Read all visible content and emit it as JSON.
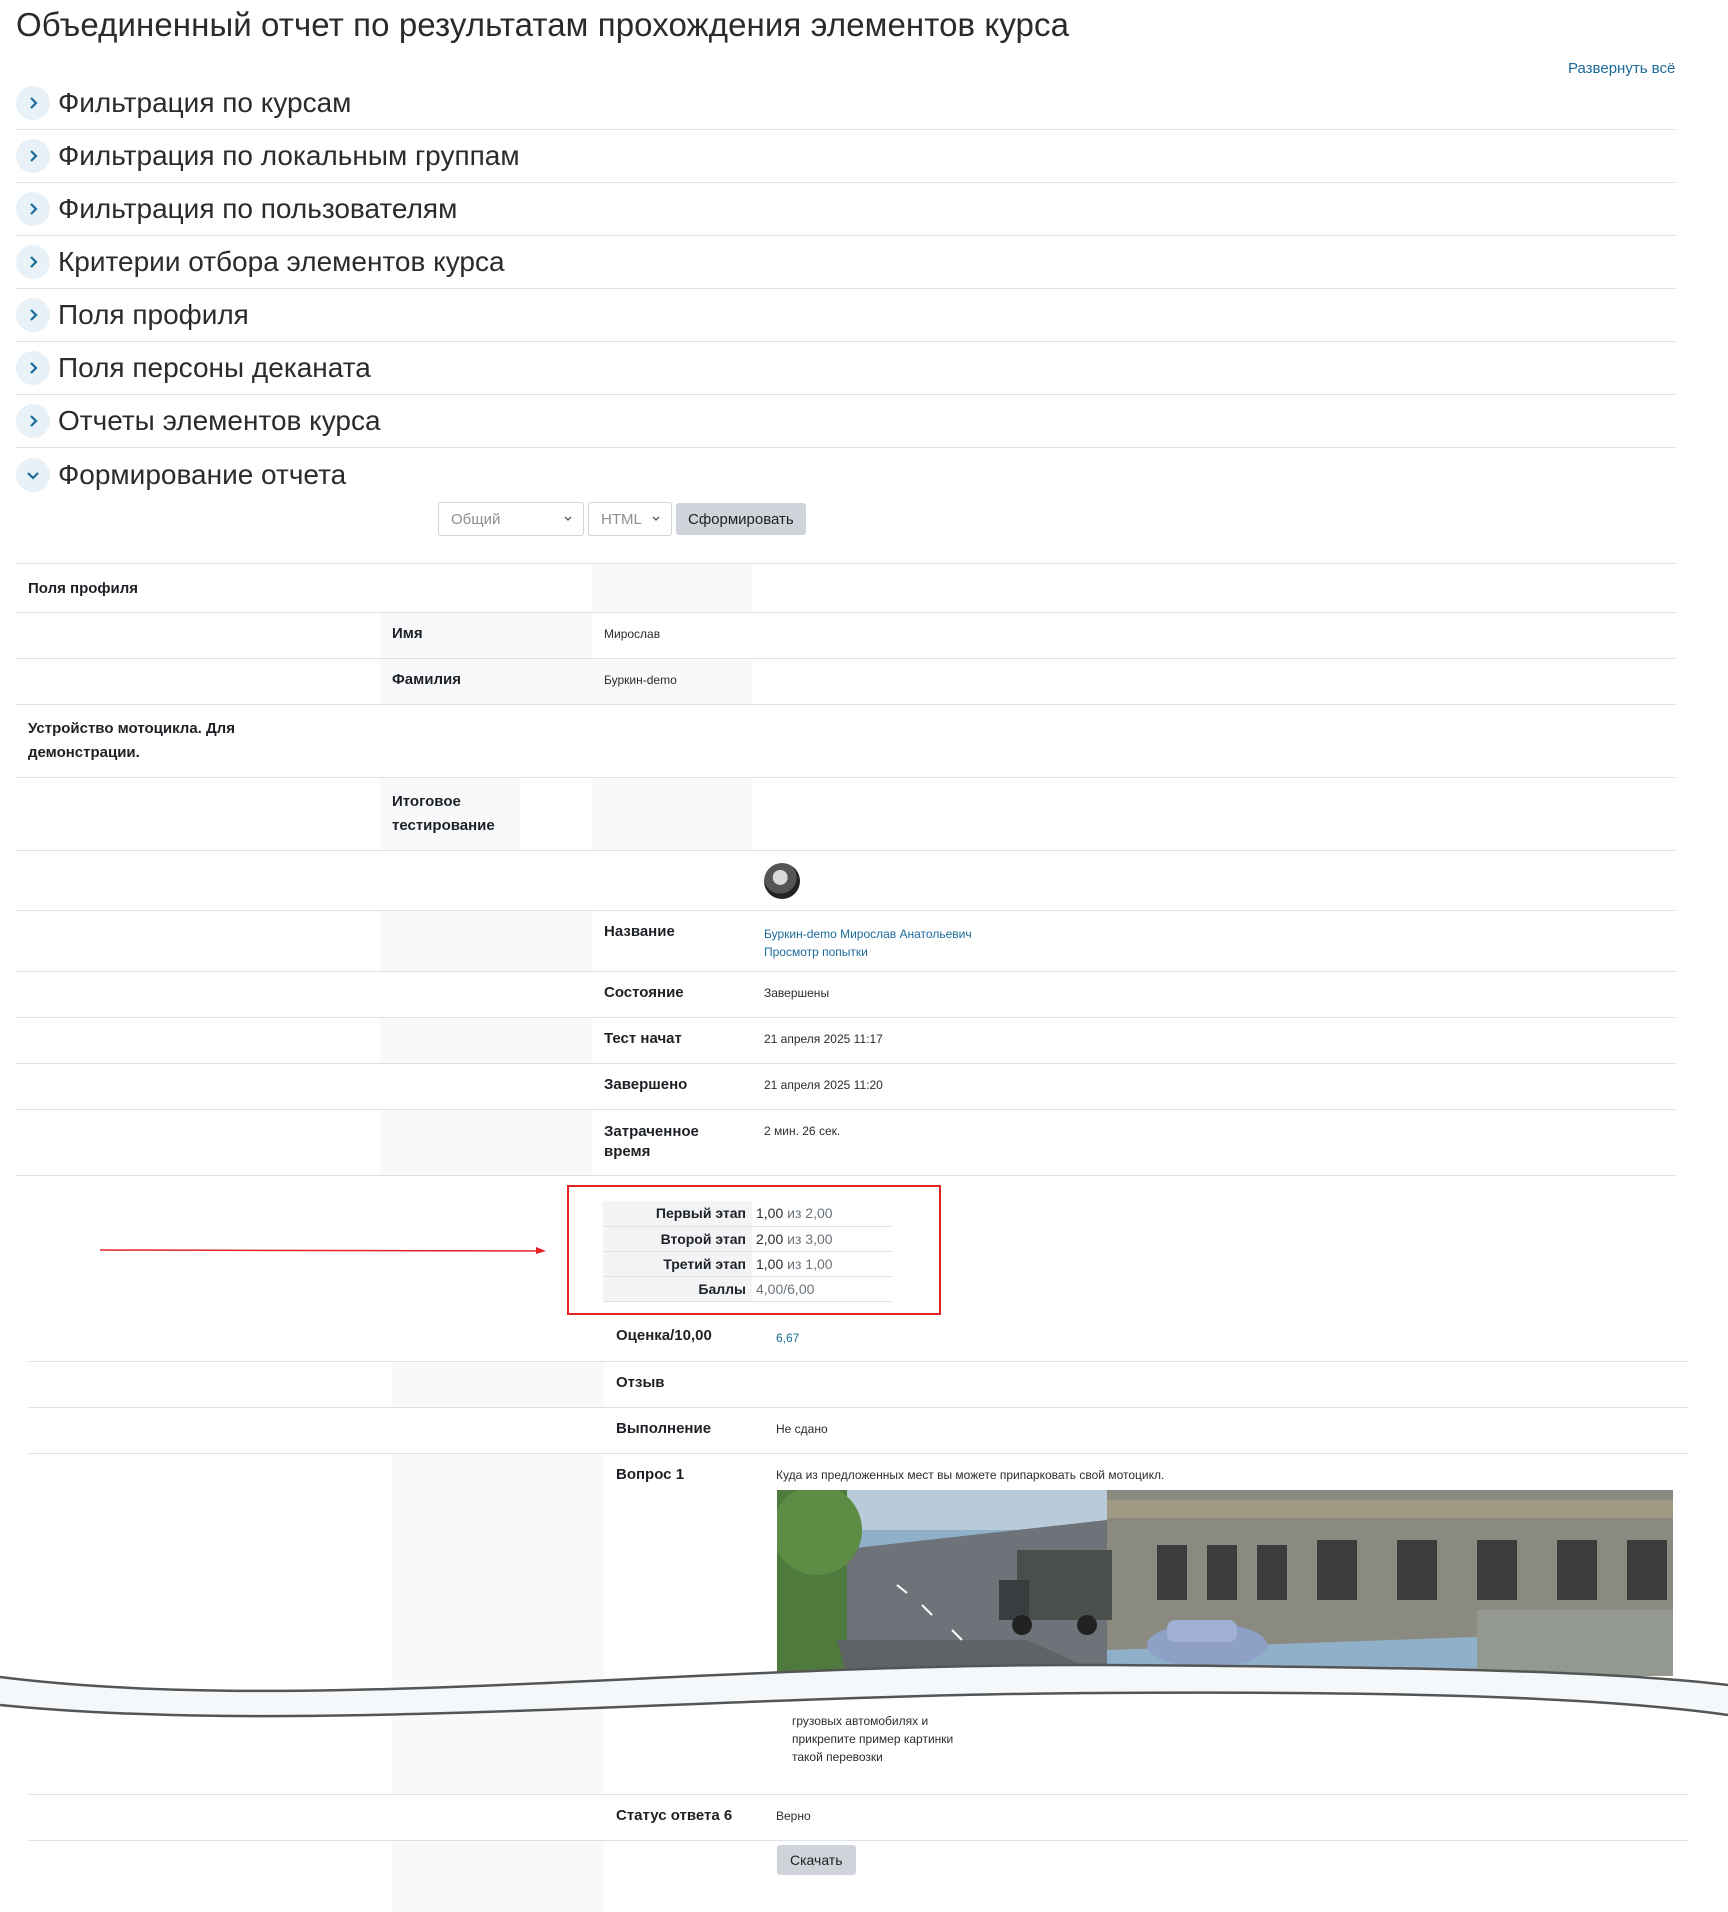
{
  "header": {
    "title": "Объединенный отчет по результатам прохождения элементов курса",
    "expand_all": "Развернуть всё"
  },
  "sections": [
    {
      "label": "Фильтрация по курсам",
      "expanded": false
    },
    {
      "label": "Фильтрация по локальным группам",
      "expanded": false
    },
    {
      "label": "Фильтрация по пользователям",
      "expanded": false
    },
    {
      "label": "Критерии отбора элементов курса",
      "expanded": false
    },
    {
      "label": "Поля профиля",
      "expanded": false
    },
    {
      "label": "Поля персоны деканата",
      "expanded": false
    },
    {
      "label": "Отчеты элементов курса",
      "expanded": false
    },
    {
      "label": "Формирование отчета",
      "expanded": true
    }
  ],
  "report_controls": {
    "type_select": "Общий",
    "format_select": "HTML",
    "generate_button": "Сформировать"
  },
  "report": {
    "profile_fields_heading": "Поля профиля",
    "first_name_label": "Имя",
    "first_name_value": "Мирослав",
    "last_name_label": "Фамилия",
    "last_name_value": "Буркин-demo",
    "course_title": "Устройство мотоцикла. Для демонстрации.",
    "quiz_title": "Итоговое тестирование",
    "name_label": "Название",
    "name_value": "Буркин-demo Мирослав Анатольевич",
    "view_attempt_link": "Просмотр попытки",
    "state_label": "Состояние",
    "state_value": "Завершены",
    "started_label": "Тест начат",
    "started_value": "21 апреля 2025 11:17",
    "finished_label": "Завершено",
    "finished_value": "21 апреля 2025 11:20",
    "time_spent_label": "Затраченное время",
    "time_spent_value": "2 мин. 26 сек.",
    "stage_grades": [
      {
        "label": "Первый этап",
        "score": "1,00",
        "sep": "из",
        "max": "2,00"
      },
      {
        "label": "Второй этап",
        "score": "2,00",
        "sep": "из",
        "max": "3,00"
      },
      {
        "label": "Третий этап",
        "score": "1,00",
        "sep": "из",
        "max": "1,00"
      },
      {
        "label": "Баллы",
        "score": "4,00/6,00",
        "sep": "",
        "max": ""
      }
    ],
    "grade_label": "Оценка/10,00",
    "grade_value": "6,67",
    "feedback_label": "Отзыв",
    "completion_label": "Выполнение",
    "completion_value": "Не сдано",
    "question_label": "Вопрос 1",
    "question_text": "Куда из предложенных мест вы можете припарковать свой мотоцикл.",
    "answer_text_lines": [
      "грузовых автомобилях и",
      "прикрепите пример картинки",
      "такой перевозки"
    ],
    "answer_status_label": "Статус ответа 6",
    "answer_status_value": "Верно",
    "download_button": "Скачать"
  },
  "colors": {
    "accent": "#1b6b9a",
    "highlight_box": "#e32222",
    "chevron_bg": "#e7f1f7"
  }
}
